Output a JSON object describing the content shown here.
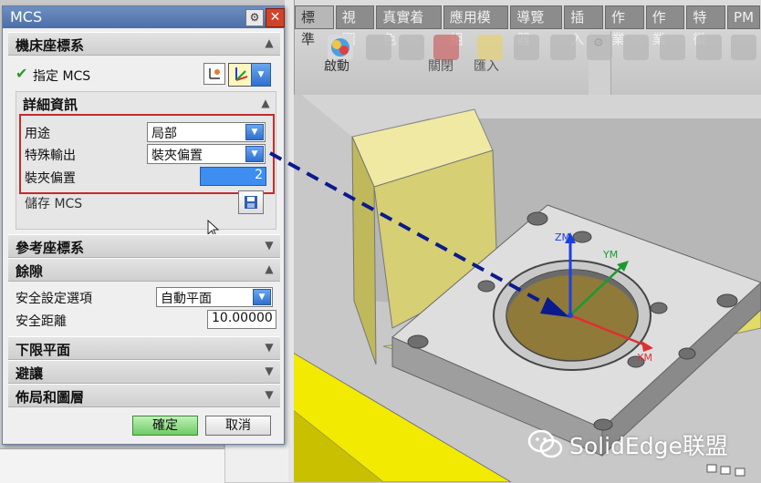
{
  "dialog": {
    "title": "MCS",
    "close_glyph": "✕",
    "gear_glyph": "⚙",
    "sections": {
      "machine_csys": "機床座標系",
      "reference_csys": "參考座標系",
      "clearance": "餘隙",
      "lower_limit": "下限平面",
      "avoidance": "避讓",
      "layout_layers": "佈局和圖層"
    },
    "specify_mcs": "指定 MCS",
    "details": {
      "header": "詳細資訊",
      "purpose_label": "用途",
      "purpose_value": "局部",
      "special_output_label": "特殊輸出",
      "special_output_value": "裝夾偏置",
      "fixture_offset_label": "裝夾偏置",
      "fixture_offset_value": "2"
    },
    "save_mcs": "儲存 MCS",
    "clearance": {
      "safety_option_label": "安全設定選項",
      "safety_option_value": "自動平面",
      "safety_distance_label": "安全距離",
      "safety_distance_value": "10.00000"
    },
    "ok_label": "確定",
    "cancel_label": "取消"
  },
  "ribbon": {
    "tabs": [
      "標準",
      "視圖",
      "真實着色",
      "應用模組",
      "導覽器",
      "插入",
      "作業",
      "作業",
      "特徵",
      "PM"
    ],
    "labels": [
      "啟動",
      "關閉",
      "匯入"
    ]
  },
  "viewport": {
    "axes": {
      "z": "ZM",
      "y": "YM",
      "x": "XM"
    },
    "watermark": "SolidEdge联盟"
  },
  "colors": {
    "accent_blue": "#2f6fd0",
    "highlight_red": "#c42b2b",
    "ok_green": "#6fcb64",
    "arrow_navy": "#0b1a8c"
  }
}
